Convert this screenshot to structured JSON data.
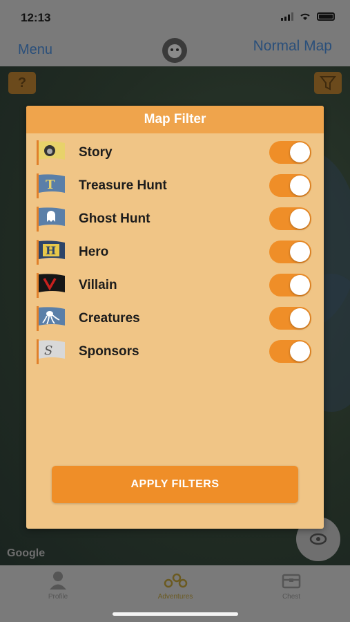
{
  "status_bar": {
    "time": "12:13"
  },
  "nav": {
    "menu_label": "Menu",
    "normal_map_label": "Normal Map",
    "logo_icon": "lion-logo-icon"
  },
  "map": {
    "help_label": "?",
    "attribution": "Google"
  },
  "modal": {
    "title": "Map Filter",
    "filters": [
      {
        "label": "Story",
        "icon": "story-flag-icon",
        "enabled": true
      },
      {
        "label": "Treasure Hunt",
        "icon": "treasure-hunt-flag-icon",
        "enabled": true
      },
      {
        "label": "Ghost Hunt",
        "icon": "ghost-hunt-flag-icon",
        "enabled": true
      },
      {
        "label": "Hero",
        "icon": "hero-flag-icon",
        "enabled": true
      },
      {
        "label": "Villain",
        "icon": "villain-flag-icon",
        "enabled": true
      },
      {
        "label": "Creatures",
        "icon": "creatures-flag-icon",
        "enabled": true
      },
      {
        "label": "Sponsors",
        "icon": "sponsors-flag-icon",
        "enabled": true
      }
    ],
    "apply_label": "APPLY FILTERS"
  },
  "tabs": [
    {
      "label": "Profile",
      "icon": "profile-icon"
    },
    {
      "label": "Adventures",
      "icon": "adventures-icon"
    },
    {
      "label": "Chest",
      "icon": "chest-icon"
    }
  ],
  "colors": {
    "accent": "#ef8e28",
    "header": "#efa44c",
    "panel": "#f0c586",
    "link": "#2a4f7a"
  }
}
